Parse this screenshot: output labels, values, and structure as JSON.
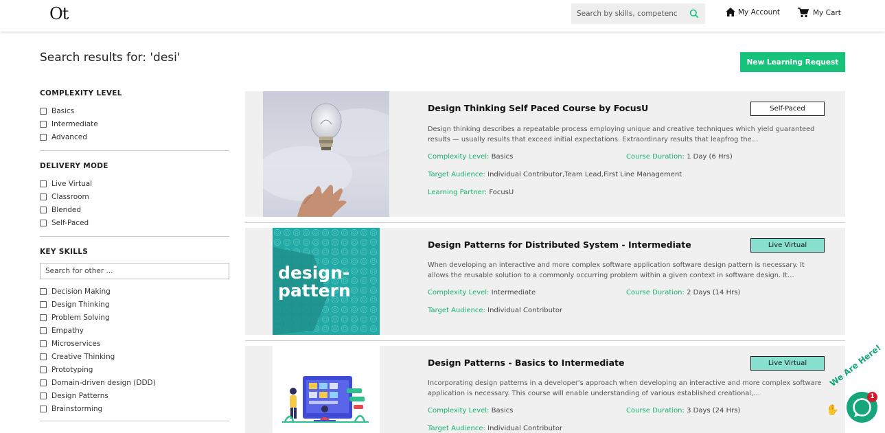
{
  "header": {
    "logo": "Ot",
    "search_placeholder": "Search by skills, competenc",
    "account_label": "My Account",
    "cart_label": "My Cart"
  },
  "page": {
    "title": "Search results for: 'desi'",
    "new_request_label": "New Learning Request"
  },
  "filters": {
    "complexity": {
      "title": "COMPLEXITY LEVEL",
      "options": [
        "Basics",
        "Intermediate",
        "Advanced"
      ]
    },
    "delivery": {
      "title": "DELIVERY MODE",
      "options": [
        "Live Virtual",
        "Classroom",
        "Blended",
        "Self-Paced"
      ]
    },
    "skills": {
      "title": "KEY SKILLS",
      "search_placeholder": "Search for other ...",
      "options": [
        "Decision Making",
        "Design Thinking",
        "Problem Solving",
        "Empathy",
        "Microservices",
        "Creative Thinking",
        "Prototyping",
        "Domain-driven design (DDD)",
        "Design Patterns",
        "Brainstorming"
      ]
    }
  },
  "courses": [
    {
      "title": "Design Thinking Self Paced Course by FocusU",
      "mode": "Self-Paced",
      "description": "Design thinking describes a repeatable process employing unique and creative techniques which yield guaranteed results — usually results that exceed initial expectations. Extraordinary results that leapfrog the…",
      "complexity_key": "Complexity Level:",
      "complexity": "Basics",
      "duration_key": "Course Duration:",
      "duration": "1 Day (6 Hrs)",
      "audience_key": "Target Audience:",
      "audience": "Individual Contributor,Team Lead,First Line Management",
      "partner_key": "Learning Partner:",
      "partner": "FocusU"
    },
    {
      "title": "Design Patterns for Distributed System - Intermediate",
      "mode": "Live Virtual",
      "description": "When developing an interactive and more complex software application software design pattern is necessary. It allows the reusable solution to a commonly occurring problem within a given context in software design. It…",
      "complexity_key": "Complexity Level:",
      "complexity": "Intermediate",
      "duration_key": "Course Duration:",
      "duration": "2 Days (14 Hrs)",
      "audience_key": "Target Audience:",
      "audience": "Individual Contributor",
      "thumb_text_1": "design-",
      "thumb_text_2": "pattern"
    },
    {
      "title": "Design Patterns - Basics to Intermediate",
      "mode": "Live Virtual",
      "description": "Incorporating design patterns in a developer's approach when developing an interactive and more complex software application is necessary. This course will enable understanding of various established creational,…",
      "complexity_key": "Complexity Level:",
      "complexity": "Basics",
      "duration_key": "Course Duration:",
      "duration": "3 Days (24 Hrs)",
      "audience_key": "Target Audience:",
      "audience": "Individual Contributor"
    }
  ],
  "chat": {
    "badge": "1",
    "tagline": "We Are Here!"
  },
  "colors": {
    "accent_green": "#17c37b",
    "live_badge": "#88e0cf",
    "card_bg": "#f0f0f0"
  }
}
